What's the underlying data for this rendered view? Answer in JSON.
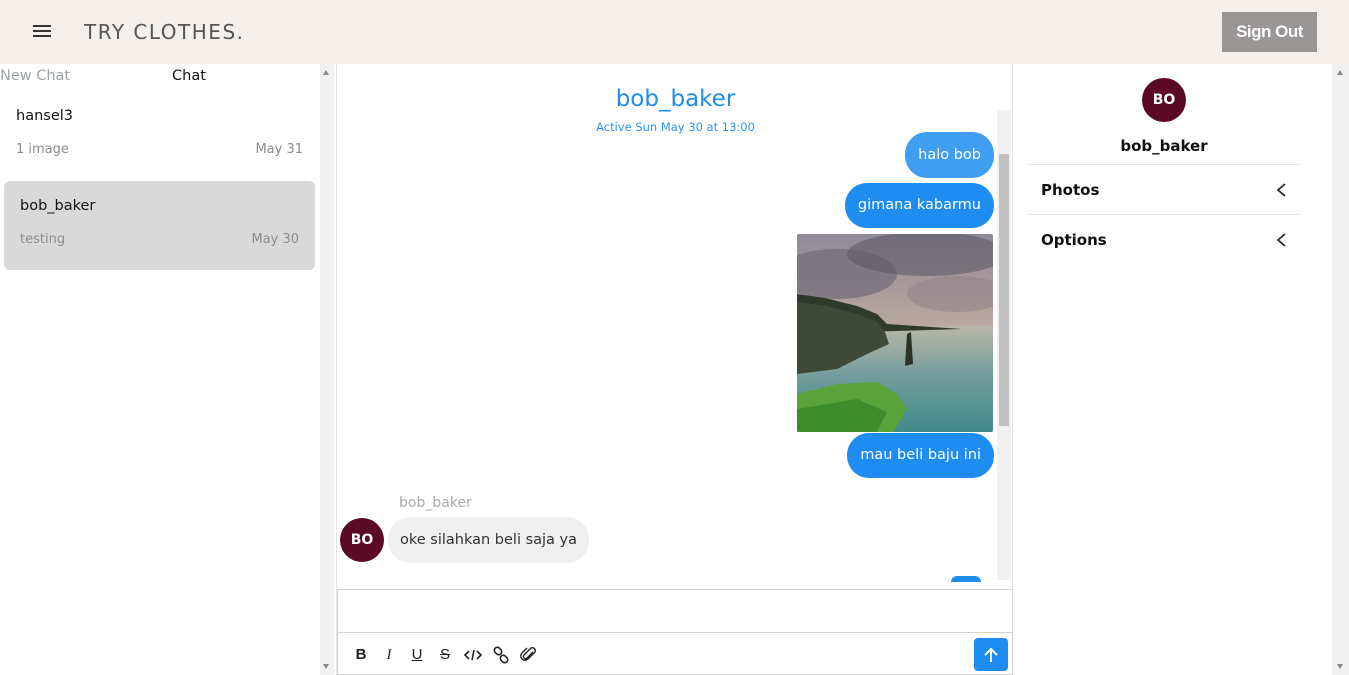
{
  "app": {
    "brand": "TRY CLOTHES.",
    "sign_out_label": "Sign Out"
  },
  "sidebar": {
    "tabs": [
      {
        "label": "New Chat",
        "active": false
      },
      {
        "label": "Chat",
        "active": true
      }
    ],
    "conversations": [
      {
        "name": "hansel3",
        "preview": "1 image",
        "date": "May 31",
        "selected": false
      },
      {
        "name": "bob_baker",
        "preview": "testing",
        "date": "May 30",
        "selected": true
      }
    ]
  },
  "chat": {
    "contact_name": "bob_baker",
    "status": "Active Sun May 30 at 13:00",
    "messages": [
      {
        "direction": "out",
        "type": "text",
        "text": "halo bob"
      },
      {
        "direction": "out",
        "type": "text",
        "text": "gimana kabarmu"
      },
      {
        "direction": "out",
        "type": "image",
        "alt": "coastal cliffs photo"
      },
      {
        "direction": "out",
        "type": "text",
        "text": "mau beli baju ini"
      },
      {
        "direction": "in",
        "type": "text",
        "sender": "bob_baker",
        "avatar": "BO",
        "text": "oke silahkan beli saja ya"
      }
    ],
    "toolbar": [
      "bold-icon",
      "italic-icon",
      "underline-icon",
      "strikethrough-icon",
      "code-icon",
      "link-icon",
      "attachment-icon",
      "send-icon"
    ]
  },
  "details": {
    "avatar": "BO",
    "name": "bob_baker",
    "sections": [
      {
        "label": "Photos"
      },
      {
        "label": "Options"
      }
    ]
  },
  "colors": {
    "accent": "#1e8cf0",
    "avatar": "#5a0a24",
    "topbar": "#f5f0ec",
    "sign_out": "#999695"
  }
}
